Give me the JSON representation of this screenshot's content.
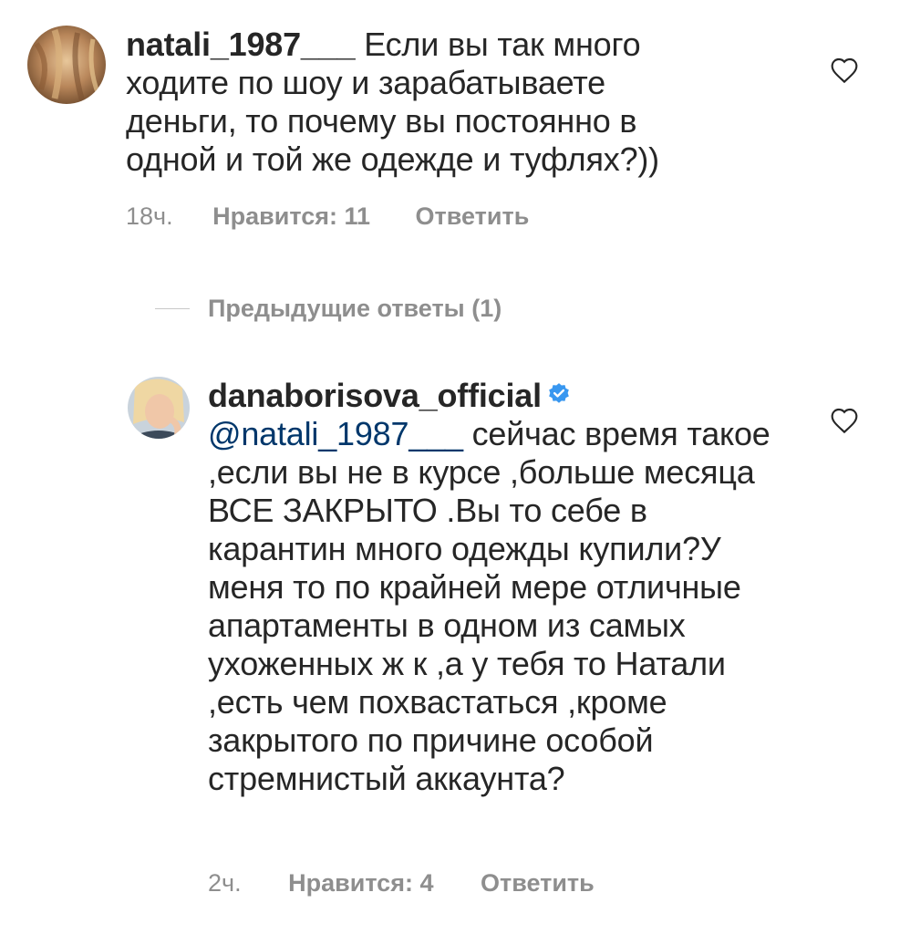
{
  "comments": [
    {
      "username": "natali_1987___",
      "text": "Если вы так много ходите по шоу и зарабатываете деньги, то почему вы постоянно в одной и той же одежде и туфлях?))",
      "time": "18ч.",
      "likes": "Нравится: 11",
      "reply": "Ответить"
    },
    {
      "username": "danaborisova_official",
      "mention": "@natali_1987___",
      "text": "сейчас время такое ,если вы не в курсе ,больше месяца ВСЕ ЗАКРЫТО .Вы то себе в карантин много одежды купили?У меня то по крайней мере отличные апартаменты в одном из самых ухоженных ж к ,а у тебя то Натали ,есть чем похвастаться ,кроме закрытого по причине особой стремнистый аккаунта?",
      "time": "2ч.",
      "likes": "Нравится: 4",
      "reply": "Ответить"
    }
  ],
  "previous_replies": "Предыдущие ответы (1)",
  "icons": {
    "like": "heart-outline-icon",
    "verified": "verified-badge-icon"
  },
  "colors": {
    "text": "#262626",
    "meta": "#8e8e8e",
    "mention": "#00376b",
    "verified": "#3897f0"
  }
}
